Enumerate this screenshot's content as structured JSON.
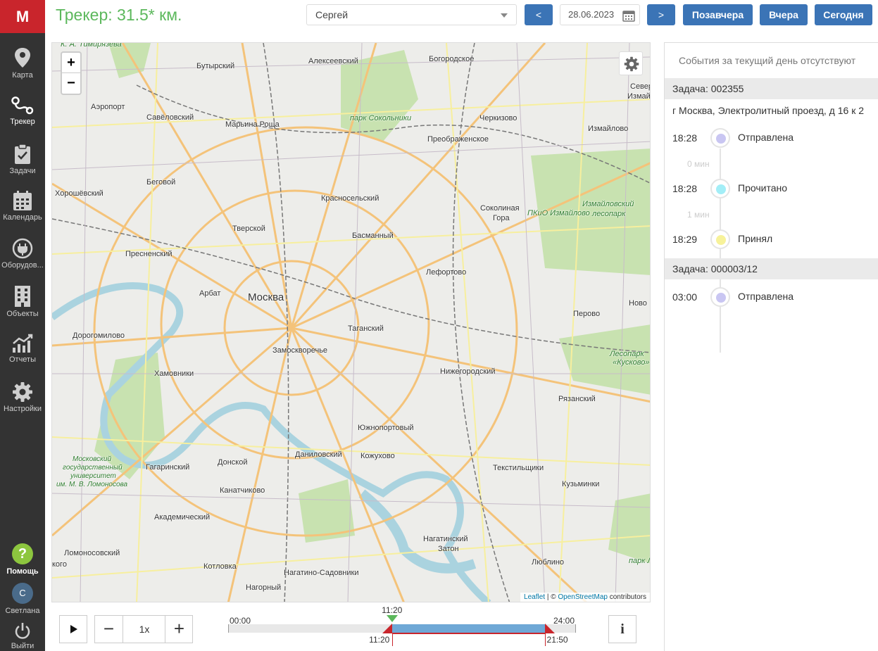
{
  "app": {
    "logo": "M"
  },
  "sidebar": {
    "items": [
      {
        "label": "Карта",
        "icon": "map-pin-icon"
      },
      {
        "label": "Трекер",
        "icon": "route-icon",
        "active": true
      },
      {
        "label": "Задачи",
        "icon": "clipboard-check-icon"
      },
      {
        "label": "Календарь",
        "icon": "calendar-icon"
      },
      {
        "label": "Оборудов...",
        "icon": "plug-icon"
      },
      {
        "label": "Объекты",
        "icon": "building-icon"
      },
      {
        "label": "Отчеты",
        "icon": "chart-icon"
      },
      {
        "label": "Настройки",
        "icon": "gear-icon"
      }
    ],
    "help": {
      "label": "Помощь",
      "symbol": "?"
    },
    "user": {
      "initial": "С",
      "name": "Светлана"
    },
    "logout": {
      "label": "Выйти"
    }
  },
  "header": {
    "title": "Трекер: 31.5* км.",
    "user_select": "Сергей",
    "prev": "<",
    "next": ">",
    "date": "28.06.2023",
    "day_before_yesterday": "Позавчера",
    "yesterday": "Вчера",
    "today": "Сегодня"
  },
  "map": {
    "zoom_in": "+",
    "zoom_out": "−",
    "attribution": {
      "leaflet": "Leaflet",
      "sep": " | © ",
      "osm": "OpenStreetMap",
      "suffix": " contributors"
    },
    "labels": {
      "timiryazeva": "К. А. Тимирязева",
      "butyrsky": "Бутырский",
      "alekseevsky": "Алексеевский",
      "bogorodskoe": "Богородское",
      "sever": "Север",
      "izmaj": "Измай",
      "aeroport": "Аэропорт",
      "savelovsky": "Савёловский",
      "maryina": "Марьина Роща",
      "sokolniki": "парк Сокольники",
      "cherkizovo": "Черкизово",
      "izmailovo": "Измайлово",
      "preobrazhenskoe": "Преображенское",
      "khoroshevsky": "Хорошёвский",
      "begovoy": "Беговой",
      "krasnoselsky": "Красносельский",
      "sokolinaya": "Соколиная",
      "gora": "Гора",
      "pkio": "ПКиО Измайлово",
      "izm_les": "Измайловский",
      "lesopark": "лесопарк",
      "tverskoy": "Тверской",
      "basmanny": "Басманный",
      "presnensky": "Пресненский",
      "lefortovo": "Лефортово",
      "arbat": "Арбат",
      "moskva": "Москва",
      "perovo": "Перово",
      "novo": "Ново",
      "tagansky": "Таганский",
      "dorogomilovo": "Дорогомилово",
      "zamoskvorechye": "Замоскворечье",
      "kuskovo1": "Лесопарк",
      "kuskovo2": "«Кусково»",
      "khamovniki": "Хамовники",
      "nizhegorodsky": "Нижегородский",
      "ryazansky": "Рязанский",
      "yuzhnoportovy": "Южнопортовый",
      "mgu1": "Московский",
      "mgu2": "государственный",
      "mgu3": "университет",
      "mgu4": "им. М. В. Ломоносова",
      "donskoy": "Донской",
      "danilovsky": "Даниловский",
      "kozhukhovo": "Кожухово",
      "gagarinsky": "Гагаринский",
      "tekstilshchiki": "Текстильщики",
      "kanatchikovo": "Канатчиково",
      "kuzminki": "Кузьминки",
      "akademichesky": "Академический",
      "nagatinsky1": "Нагатинский",
      "nagatinsky2": "Затон",
      "lomonosovsky": "Ломоносовский",
      "lyublino": "Люблино",
      "park": "парк Л",
      "kotlovka": "Котловка",
      "nagatino_sad": "Нагатино-Садовники",
      "koe": "кого",
      "nagorny": "Нагорный"
    }
  },
  "player": {
    "speed": "1x",
    "minus": "−",
    "plus": "+",
    "info": "i",
    "timeline": {
      "start_label": "00:00",
      "end_label": "24:00",
      "cursor_time": "11:20",
      "range_start": "11:20",
      "range_end": "21:50",
      "cursor_fraction": 0.472,
      "range_start_fraction": 0.472,
      "range_end_fraction": 0.91
    }
  },
  "events": {
    "empty_text": "События за текущий день отсутствуют",
    "tasks": [
      {
        "title": "Задача: 002355",
        "address": "г Москва, Электролитный проезд, д 16 к 2",
        "events": [
          {
            "time": "18:28",
            "status": "Отправлена",
            "color": "#c9c6f2"
          },
          {
            "gap": "0 мин"
          },
          {
            "time": "18:28",
            "status": "Прочитано",
            "color": "#a3eef7"
          },
          {
            "gap": "1 мин"
          },
          {
            "time": "18:29",
            "status": "Принял",
            "color": "#f7f29a"
          }
        ]
      },
      {
        "title": "Задача: 000003/12",
        "events": [
          {
            "time": "03:00",
            "status": "Отправлена",
            "color": "#c9c6f2"
          }
        ]
      }
    ]
  },
  "colors": {
    "accent": "#3b74b6",
    "title_green": "#5cb85c",
    "logo_red": "#c9252c",
    "sidebar_bg": "#333333"
  }
}
